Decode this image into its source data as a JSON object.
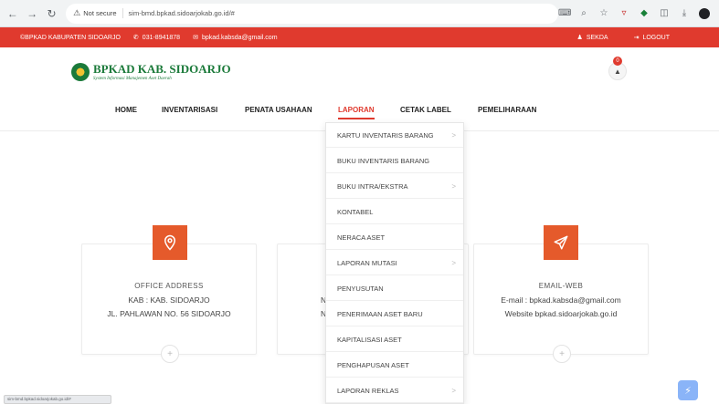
{
  "browser": {
    "security_label": "Not secure",
    "url": "sim-bmd.bpkad.sidoarjokab.go.id/#",
    "status_url": "sim-bmd.bpkad.sidoarjokab.go.id/#"
  },
  "topbar": {
    "org": "©BPKAD KABUPATEN SIDOARJO",
    "phone": "031-8941878",
    "email": "bpkad.kabsda@gmail.com",
    "user": "SEKDA",
    "logout": "LOGOUT"
  },
  "header": {
    "logo_title": "BPKAD KAB. SIDOARJO",
    "logo_subtitle": "System Informasi Manajemen Aset Daerah",
    "notif_count": "0"
  },
  "menu": {
    "items": [
      "HOME",
      "INVENTARISASI",
      "PENATA USAHAAN",
      "LAPORAN",
      "CETAK LABEL",
      "PEMELIHARAAN"
    ],
    "active": "LAPORAN"
  },
  "dropdown": {
    "items": [
      {
        "label": "KARTU INVENTARIS BARANG",
        "has_sub": true
      },
      {
        "label": "BUKU INVENTARIS BARANG",
        "has_sub": false
      },
      {
        "label": "BUKU INTRA/EKSTRA",
        "has_sub": true
      },
      {
        "label": "KONTABEL",
        "has_sub": false
      },
      {
        "label": "NERACA ASET",
        "has_sub": false
      },
      {
        "label": "LAPORAN MUTASI",
        "has_sub": true
      },
      {
        "label": "PENYUSUTAN",
        "has_sub": false
      },
      {
        "label": "PENERIMAAN ASET BARU",
        "has_sub": false
      },
      {
        "label": "KAPITALISASI ASET",
        "has_sub": false
      },
      {
        "label": "PENGHAPUSAN ASET",
        "has_sub": false
      },
      {
        "label": "LAPORAN REKLAS",
        "has_sub": true
      }
    ],
    "chevron": ">"
  },
  "cards": {
    "office": {
      "label": "OFFICE ADDRESS",
      "line1": "KAB : KAB. SIDOARJO",
      "line2": "JL. PAHLAWAN NO. 56 SIDOARJO"
    },
    "middle": {
      "line1": "N",
      "line2": "N"
    },
    "email": {
      "label": "EMAIL-WEB",
      "line1": "E-mail : bpkad.kabsda@gmail.com",
      "line2": "Website bpkad.sidoarjokab.go.id"
    },
    "plus": "+"
  },
  "colors": {
    "brand_red": "#e03a2e",
    "icon_orange": "#e55a2b",
    "logo_green": "#1b7a3a"
  }
}
